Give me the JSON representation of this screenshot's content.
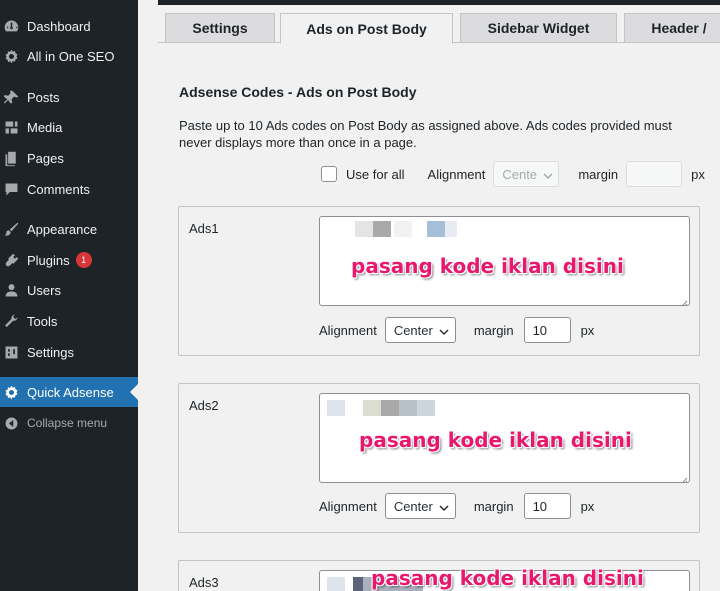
{
  "sidebar": {
    "items": [
      {
        "label": "Dashboard",
        "icon": "dashboard-icon"
      },
      {
        "label": "All in One SEO",
        "icon": "seo-gear-icon"
      },
      {
        "label": "Posts",
        "icon": "pushpin-icon"
      },
      {
        "label": "Media",
        "icon": "media-icon"
      },
      {
        "label": "Pages",
        "icon": "pages-icon"
      },
      {
        "label": "Comments",
        "icon": "comment-icon"
      },
      {
        "label": "Appearance",
        "icon": "paintbrush-icon"
      },
      {
        "label": "Plugins",
        "icon": "plugin-icon",
        "badge": "1"
      },
      {
        "label": "Users",
        "icon": "user-icon"
      },
      {
        "label": "Tools",
        "icon": "wrench-icon"
      },
      {
        "label": "Settings",
        "icon": "settings-icon"
      },
      {
        "label": "Quick Adsense",
        "icon": "gear-icon"
      },
      {
        "label": "Collapse menu",
        "icon": "collapse-icon"
      }
    ]
  },
  "tabs": [
    "Settings",
    "Ads on Post Body",
    "Sidebar Widget",
    "Header /"
  ],
  "main": {
    "section_title": "Adsense Codes - Ads on Post Body",
    "description_line1": "Paste up to 10 Ads codes on Post Body as assigned above. Ads codes provided must",
    "description_line2": "never displays more than once in a page.",
    "global": {
      "use_for_all_label": "Use for all",
      "alignment_label": "Alignment",
      "alignment_value": "Cente",
      "margin_label": "margin",
      "margin_value": "",
      "unit": "px"
    },
    "ads": [
      {
        "label": "Ads1",
        "alignment_label": "Alignment",
        "alignment_value": "Center",
        "margin_label": "margin",
        "margin_value": "10",
        "unit": "px"
      },
      {
        "label": "Ads2",
        "alignment_label": "Alignment",
        "alignment_value": "Center",
        "margin_label": "margin",
        "margin_value": "10",
        "unit": "px"
      },
      {
        "label": "Ads3"
      }
    ],
    "overlay_text": "pasang kode iklan disini"
  },
  "colors": {
    "sidebar_bg": "#1d2327",
    "active_menu": "#2271b1",
    "badge": "#d63638",
    "overlay_text": "#e8186f"
  }
}
